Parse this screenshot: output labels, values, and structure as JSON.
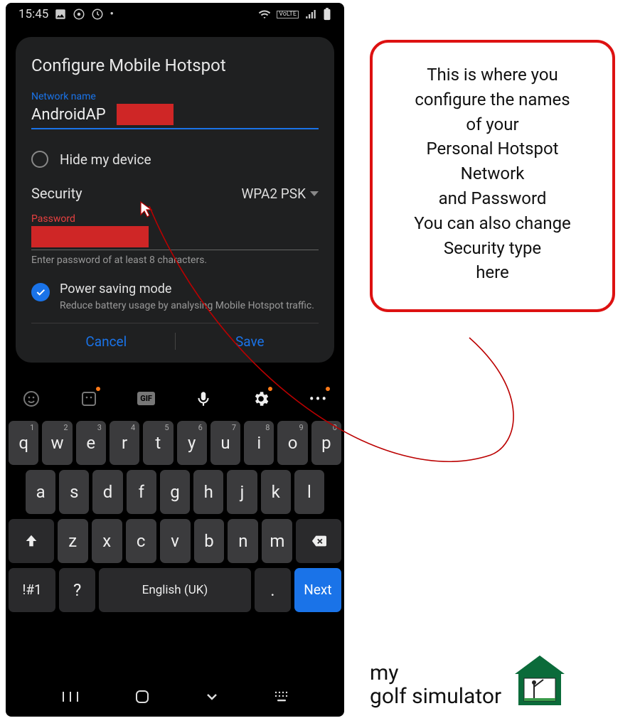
{
  "status": {
    "time": "15:45",
    "volte": "VoLTE"
  },
  "card": {
    "title": "Configure Mobile Hotspot",
    "network_label": "Network name",
    "network_value": "AndroidAP",
    "hide_label": "Hide my device",
    "security_label": "Security",
    "security_value": "WPA2 PSK",
    "password_label": "Password",
    "password_helper": "Enter password of at least 8 characters.",
    "powersave_title": "Power saving mode",
    "powersave_sub": "Reduce battery usage by analysing Mobile Hotspot traffic.",
    "cancel": "Cancel",
    "save": "Save"
  },
  "keyboard": {
    "row1": [
      {
        "k": "q",
        "n": "1"
      },
      {
        "k": "w",
        "n": "2"
      },
      {
        "k": "e",
        "n": "3"
      },
      {
        "k": "r",
        "n": "4"
      },
      {
        "k": "t",
        "n": "5"
      },
      {
        "k": "y",
        "n": "6"
      },
      {
        "k": "u",
        "n": "7"
      },
      {
        "k": "i",
        "n": "8"
      },
      {
        "k": "o",
        "n": "9"
      },
      {
        "k": "p",
        "n": "0"
      }
    ],
    "row2": [
      "a",
      "s",
      "d",
      "f",
      "g",
      "h",
      "j",
      "k",
      "l"
    ],
    "row3": [
      "z",
      "x",
      "c",
      "v",
      "b",
      "n",
      "m"
    ],
    "sym": "!#1",
    "q": "?",
    "lang": "English (UK)",
    "dot": ".",
    "next": "Next"
  },
  "callout": {
    "l1": "This is where you",
    "l2": "configure the names",
    "l3": "of your",
    "l4": "Personal Hotspot",
    "l5": "Network",
    "l6": "and Password",
    "l7": "You can also change",
    "l8": "Security type",
    "l9": "here"
  },
  "logo": {
    "l1": "my",
    "l2": "golf simulator"
  }
}
